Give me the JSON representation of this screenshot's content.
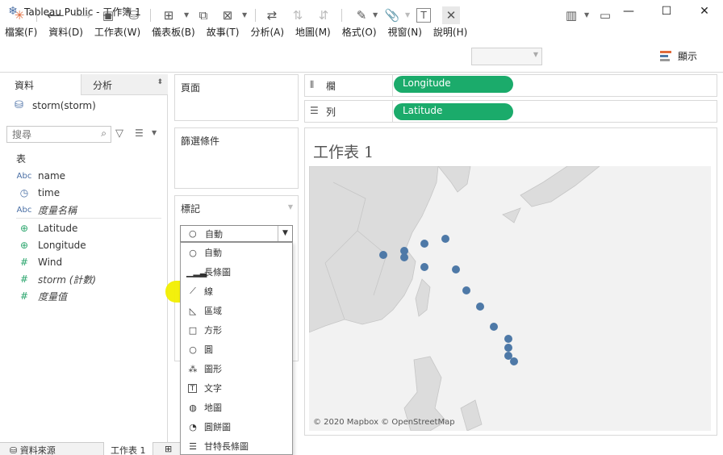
{
  "window": {
    "title": "Tableau Public - 工作簿 1",
    "minimize_icon": "minimize-icon",
    "maximize_icon": "maximize-icon",
    "close_icon": "close-icon"
  },
  "menu": [
    "檔案(F)",
    "資料(D)",
    "工作表(W)",
    "儀表板(B)",
    "故事(T)",
    "分析(A)",
    "地圖(M)",
    "格式(O)",
    "視窗(N)",
    "說明(H)"
  ],
  "toolbar": {
    "show_me_label": "顯示"
  },
  "left_pane": {
    "tab_data": "資料",
    "tab_analysis": "分析",
    "data_source": "storm(storm)",
    "search_placeholder": "搜尋",
    "section_title": "表",
    "fields": [
      {
        "icon": "Abc",
        "name": "name"
      },
      {
        "icon": "date-icon",
        "name": "time"
      },
      {
        "icon": "Abc",
        "name": "度量名稱"
      },
      {
        "icon": "globe-icon",
        "name": "Latitude"
      },
      {
        "icon": "globe-icon",
        "name": "Longitude"
      },
      {
        "icon": "#",
        "name": "Wind"
      },
      {
        "icon": "#",
        "name": "storm (計數)"
      },
      {
        "icon": "#",
        "name": "度量值"
      }
    ]
  },
  "bottom_tabs": {
    "data_source": "資料來源",
    "sheet": "工作表 1"
  },
  "cards": {
    "pages": "頁面",
    "filters": "篩選條件",
    "marks": "標記"
  },
  "mark_type": {
    "selected": "自動",
    "options": [
      "自動",
      "長條圖",
      "線",
      "區域",
      "方形",
      "圓",
      "圖形",
      "文字",
      "地圖",
      "圓餅圖",
      "甘特長條圖"
    ]
  },
  "shelves": {
    "columns_label": "欄",
    "columns_pill": "Longitude",
    "rows_label": "列",
    "rows_pill": "Latitude"
  },
  "view": {
    "sheet_title": "工作表 1",
    "attribution": "© 2020 Mapbox © OpenStreetMap",
    "mark_color": "#4e79a7"
  },
  "colors": {
    "pill": "#1bab6b",
    "highlight": "#f2ef00"
  }
}
